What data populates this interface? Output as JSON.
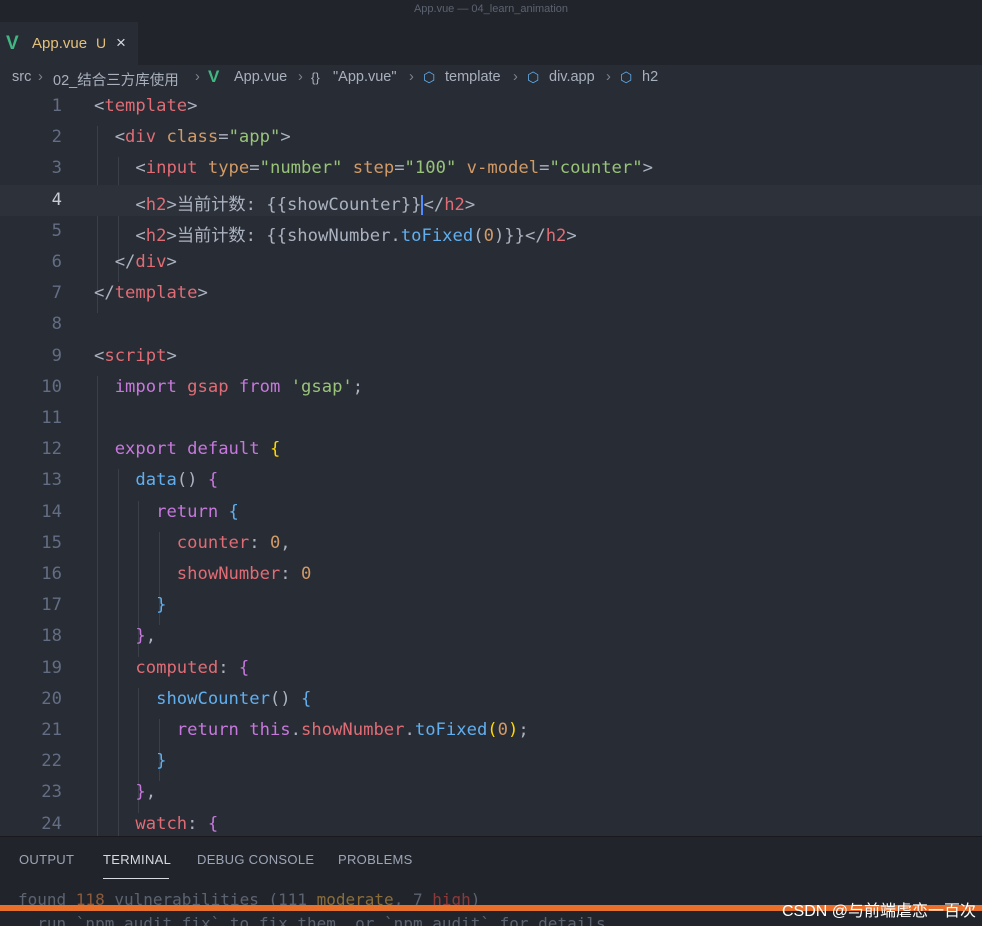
{
  "window": {
    "title": "App.vue — 04_learn_animation"
  },
  "tab": {
    "file_icon": "vue-logo-icon",
    "name": "App.vue",
    "status": "U",
    "close_glyph": "×"
  },
  "breadcrumb": {
    "src": "src",
    "folder": "02_结合三方库使用",
    "file": "App.vue",
    "braces": "{}",
    "component": "\"App.vue\"",
    "template": "template",
    "div": "div.app",
    "h2": "h2"
  },
  "editor": {
    "current_line": 4,
    "line_numbers": [
      "1",
      "2",
      "3",
      "4",
      "5",
      "6",
      "7",
      "8",
      "9",
      "10",
      "11",
      "12",
      "13",
      "14",
      "15",
      "16",
      "17",
      "18",
      "19",
      "20",
      "21",
      "22",
      "23",
      "24"
    ],
    "lines": [
      [
        [
          "tk-punc",
          "<"
        ],
        [
          "tk-tag",
          "template"
        ],
        [
          "tk-punc",
          ">"
        ]
      ],
      [
        [
          "tk-punc",
          "  <"
        ],
        [
          "tk-tag",
          "div"
        ],
        [
          "tk-punc",
          " "
        ],
        [
          "tk-attr",
          "class"
        ],
        [
          "tk-punc",
          "="
        ],
        [
          "tk-str",
          "\"app\""
        ],
        [
          "tk-punc",
          ">"
        ]
      ],
      [
        [
          "tk-punc",
          "    <"
        ],
        [
          "tk-tag",
          "input"
        ],
        [
          "tk-punc",
          " "
        ],
        [
          "tk-attr",
          "type"
        ],
        [
          "tk-punc",
          "="
        ],
        [
          "tk-str",
          "\"number\""
        ],
        [
          "tk-punc",
          " "
        ],
        [
          "tk-attr",
          "step"
        ],
        [
          "tk-punc",
          "="
        ],
        [
          "tk-str",
          "\"100\""
        ],
        [
          "tk-punc",
          " "
        ],
        [
          "tk-attr",
          "v-model"
        ],
        [
          "tk-punc",
          "="
        ],
        [
          "tk-str",
          "\"counter\""
        ],
        [
          "tk-punc",
          ">"
        ]
      ],
      [
        [
          "tk-punc",
          "    <"
        ],
        [
          "tk-tag",
          "h2"
        ],
        [
          "tk-punc",
          ">"
        ],
        [
          "tk-text",
          "当前计数: {{showCounter}}"
        ],
        [
          "tk-cursor",
          "<"
        ],
        [
          "tk-punc",
          "/"
        ],
        [
          "tk-tag",
          "h2"
        ],
        [
          "tk-punc",
          ">"
        ]
      ],
      [
        [
          "tk-punc",
          "    <"
        ],
        [
          "tk-tag",
          "h2"
        ],
        [
          "tk-punc",
          ">"
        ],
        [
          "tk-text",
          "当前计数: {{showNumber."
        ],
        [
          "tk-fn",
          "toFixed"
        ],
        [
          "tk-punc",
          "("
        ],
        [
          "tk-num",
          "0"
        ],
        [
          "tk-punc",
          ")}}</"
        ],
        [
          "tk-tag",
          "h2"
        ],
        [
          "tk-punc",
          ">"
        ]
      ],
      [
        [
          "tk-punc",
          "  </"
        ],
        [
          "tk-tag",
          "div"
        ],
        [
          "tk-punc",
          ">"
        ]
      ],
      [
        [
          "tk-punc",
          "</"
        ],
        [
          "tk-tag",
          "template"
        ],
        [
          "tk-punc",
          ">"
        ]
      ],
      [],
      [
        [
          "tk-punc",
          "<"
        ],
        [
          "tk-tag",
          "script"
        ],
        [
          "tk-punc",
          ">"
        ]
      ],
      [
        [
          "tk-punc",
          "  "
        ],
        [
          "tk-kw",
          "import"
        ],
        [
          "tk-punc",
          " "
        ],
        [
          "tk-prop",
          "gsap"
        ],
        [
          "tk-punc",
          " "
        ],
        [
          "tk-kw",
          "from"
        ],
        [
          "tk-punc",
          " "
        ],
        [
          "tk-str",
          "'gsap'"
        ],
        [
          "tk-punc",
          ";"
        ]
      ],
      [],
      [
        [
          "tk-punc",
          "  "
        ],
        [
          "tk-kw",
          "export"
        ],
        [
          "tk-punc",
          " "
        ],
        [
          "tk-kw",
          "default"
        ],
        [
          "tk-punc",
          " "
        ],
        [
          "tk-brace",
          "{"
        ]
      ],
      [
        [
          "tk-punc",
          "    "
        ],
        [
          "tk-fn",
          "data"
        ],
        [
          "tk-punc",
          "() "
        ],
        [
          "tk-kw",
          "{"
        ]
      ],
      [
        [
          "tk-punc",
          "      "
        ],
        [
          "tk-kw",
          "return"
        ],
        [
          "tk-punc",
          " "
        ],
        [
          "tk-fn",
          "{"
        ]
      ],
      [
        [
          "tk-punc",
          "        "
        ],
        [
          "tk-prop",
          "counter"
        ],
        [
          "tk-punc",
          ": "
        ],
        [
          "tk-num",
          "0"
        ],
        [
          "tk-punc",
          ","
        ]
      ],
      [
        [
          "tk-punc",
          "        "
        ],
        [
          "tk-prop",
          "showNumber"
        ],
        [
          "tk-punc",
          ": "
        ],
        [
          "tk-num",
          "0"
        ]
      ],
      [
        [
          "tk-punc",
          "      "
        ],
        [
          "tk-fn",
          "}"
        ]
      ],
      [
        [
          "tk-punc",
          "    "
        ],
        [
          "tk-kw",
          "}"
        ],
        [
          "tk-punc",
          ","
        ]
      ],
      [
        [
          "tk-punc",
          "    "
        ],
        [
          "tk-prop",
          "computed"
        ],
        [
          "tk-punc",
          ": "
        ],
        [
          "tk-kw",
          "{"
        ]
      ],
      [
        [
          "tk-punc",
          "      "
        ],
        [
          "tk-fn",
          "showCounter"
        ],
        [
          "tk-punc",
          "() "
        ],
        [
          "tk-fn",
          "{"
        ]
      ],
      [
        [
          "tk-punc",
          "        "
        ],
        [
          "tk-kw",
          "return"
        ],
        [
          "tk-punc",
          " "
        ],
        [
          "tk-kw",
          "this"
        ],
        [
          "tk-punc",
          "."
        ],
        [
          "tk-prop",
          "showNumber"
        ],
        [
          "tk-punc",
          "."
        ],
        [
          "tk-fn",
          "toFixed"
        ],
        [
          "tk-brace",
          "("
        ],
        [
          "tk-num",
          "0"
        ],
        [
          "tk-brace",
          ")"
        ],
        [
          "tk-punc",
          ";"
        ]
      ],
      [
        [
          "tk-punc",
          "      "
        ],
        [
          "tk-fn",
          "}"
        ]
      ],
      [
        [
          "tk-punc",
          "    "
        ],
        [
          "tk-kw",
          "}"
        ],
        [
          "tk-punc",
          ","
        ]
      ],
      [
        [
          "tk-punc",
          "    "
        ],
        [
          "tk-prop",
          "watch"
        ],
        [
          "tk-punc",
          ": "
        ],
        [
          "tk-kw",
          "{"
        ]
      ]
    ]
  },
  "panel": {
    "tabs": [
      {
        "label": "OUTPUT",
        "active": false
      },
      {
        "label": "TERMINAL",
        "active": true
      },
      {
        "label": "DEBUG CONSOLE",
        "active": false
      },
      {
        "label": "PROBLEMS",
        "active": false
      }
    ]
  },
  "terminal": {
    "line1": {
      "prefix": "found ",
      "count": "118",
      "mid": " vulnerabilities (111 ",
      "moderate": "moderate",
      "sep": ", 7 ",
      "high": "high",
      "suffix": ")"
    },
    "line2": "  run `npm audit fix` to fix them, or `npm audit` for details"
  },
  "watermark": "CSDN @与前端虐恋一百次",
  "colors": {
    "accent_progress": "#e8702a",
    "vue_green": "#41b883"
  }
}
